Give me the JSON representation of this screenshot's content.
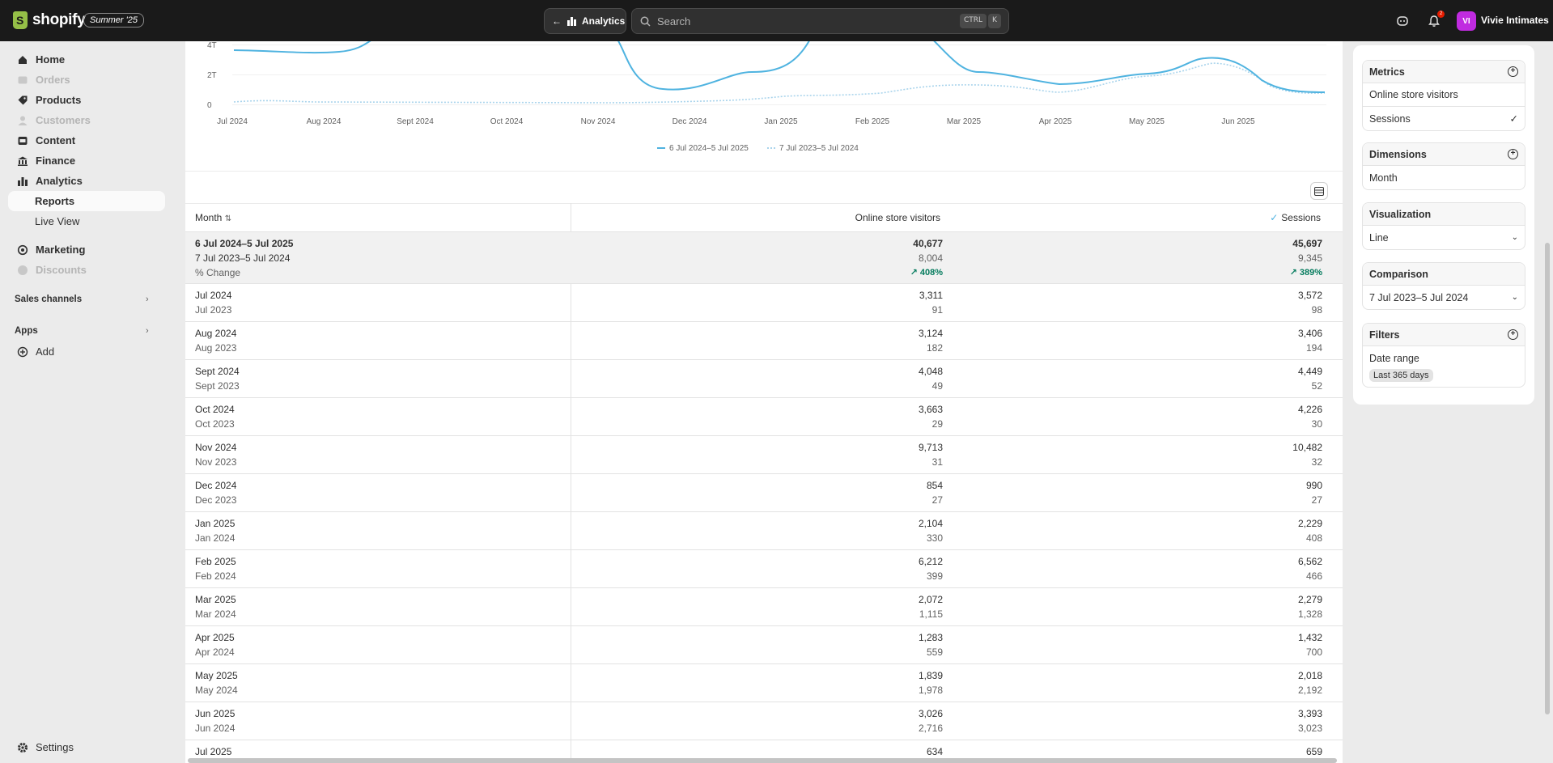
{
  "topbar": {
    "logo_text": "shopify",
    "edition": "Summer '25",
    "back_label": "Analytics",
    "search_placeholder": "Search",
    "kbd_ctrl": "CTRL",
    "kbd_k": "K",
    "notification_count": "2",
    "avatar_initials": "VI",
    "store_name": "Vivie Intimates"
  },
  "sidebar": {
    "items": [
      {
        "label": "Home",
        "icon": "home-icon"
      },
      {
        "label": "Orders",
        "icon": "inbox-icon"
      },
      {
        "label": "Products",
        "icon": "tag-icon"
      },
      {
        "label": "Customers",
        "icon": "person-icon"
      },
      {
        "label": "Content",
        "icon": "content-icon"
      },
      {
        "label": "Finance",
        "icon": "bank-icon"
      },
      {
        "label": "Analytics",
        "icon": "bar-chart-icon"
      },
      {
        "label": "Reports"
      },
      {
        "label": "Live View"
      },
      {
        "label": "Marketing",
        "icon": "target-icon"
      },
      {
        "label": "Discounts",
        "icon": "discount-icon"
      }
    ],
    "sales_channels": "Sales channels",
    "apps": "Apps",
    "add": "Add",
    "settings": "Settings"
  },
  "chart": {
    "y_ticks": [
      "4T",
      "2T",
      "0"
    ],
    "x_ticks": [
      "Jul 2024",
      "Aug 2024",
      "Sept 2024",
      "Oct 2024",
      "Nov 2024",
      "Dec 2024",
      "Jan 2025",
      "Feb 2025",
      "Mar 2025",
      "Apr 2025",
      "May 2025",
      "Jun 2025"
    ],
    "legend": [
      "6 Jul 2024–5 Jul 2025",
      "7 Jul 2023–5 Jul 2024"
    ],
    "colors": {
      "current": "#4fb3e0",
      "previous": "#a9d4ec"
    }
  },
  "table": {
    "headers": {
      "month": "Month",
      "online": "Online store visitors",
      "sessions": "Sessions"
    },
    "summary": {
      "period1": "6 Jul 2024–5 Jul 2025",
      "period2": "7 Jul 2023–5 Jul 2024",
      "change_label": "% Change",
      "online": [
        "40,677",
        "8,004",
        "408%"
      ],
      "sessions": [
        "45,697",
        "9,345",
        "389%"
      ]
    },
    "rows": [
      {
        "m1": "Jul 2024",
        "m2": "Jul 2023",
        "o1": "3,311",
        "o2": "91",
        "s1": "3,572",
        "s2": "98"
      },
      {
        "m1": "Aug 2024",
        "m2": "Aug 2023",
        "o1": "3,124",
        "o2": "182",
        "s1": "3,406",
        "s2": "194"
      },
      {
        "m1": "Sept 2024",
        "m2": "Sept 2023",
        "o1": "4,048",
        "o2": "49",
        "s1": "4,449",
        "s2": "52"
      },
      {
        "m1": "Oct 2024",
        "m2": "Oct 2023",
        "o1": "3,663",
        "o2": "29",
        "s1": "4,226",
        "s2": "30"
      },
      {
        "m1": "Nov 2024",
        "m2": "Nov 2023",
        "o1": "9,713",
        "o2": "31",
        "s1": "10,482",
        "s2": "32"
      },
      {
        "m1": "Dec 2024",
        "m2": "Dec 2023",
        "o1": "854",
        "o2": "27",
        "s1": "990",
        "s2": "27"
      },
      {
        "m1": "Jan 2025",
        "m2": "Jan 2024",
        "o1": "2,104",
        "o2": "330",
        "s1": "2,229",
        "s2": "408"
      },
      {
        "m1": "Feb 2025",
        "m2": "Feb 2024",
        "o1": "6,212",
        "o2": "399",
        "s1": "6,562",
        "s2": "466"
      },
      {
        "m1": "Mar 2025",
        "m2": "Mar 2024",
        "o1": "2,072",
        "o2": "1,115",
        "s1": "2,279",
        "s2": "1,328"
      },
      {
        "m1": "Apr 2025",
        "m2": "Apr 2024",
        "o1": "1,283",
        "o2": "559",
        "s1": "1,432",
        "s2": "700"
      },
      {
        "m1": "May 2025",
        "m2": "May 2024",
        "o1": "1,839",
        "o2": "1,978",
        "s1": "2,018",
        "s2": "2,192"
      },
      {
        "m1": "Jun 2025",
        "m2": "Jun 2024",
        "o1": "3,026",
        "o2": "2,716",
        "s1": "3,393",
        "s2": "3,023"
      },
      {
        "m1": "Jul 2025",
        "m2": "",
        "o1": "634",
        "o2": "",
        "s1": "659",
        "s2": ""
      }
    ]
  },
  "panel": {
    "metrics_title": "Metrics",
    "metric1": "Online store visitors",
    "metric2": "Sessions",
    "dimensions_title": "Dimensions",
    "dimension1": "Month",
    "visualization_title": "Visualization",
    "visualization_value": "Line",
    "comparison_title": "Comparison",
    "comparison_value": "7 Jul 2023–5 Jul 2024",
    "filters_title": "Filters",
    "filter_label": "Date range",
    "filter_tag": "Last 365 days"
  }
}
